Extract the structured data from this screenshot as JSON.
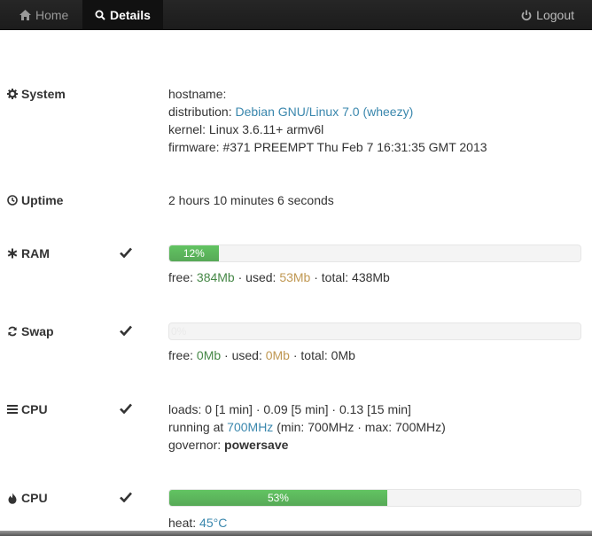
{
  "nav": {
    "home_label": "Home",
    "details_label": "Details",
    "logout_label": "Logout"
  },
  "system": {
    "label": "System",
    "hostname_label": "hostname:",
    "distribution_label": "distribution:",
    "distribution_value": "Debian GNU/Linux 7.0 (wheezy)",
    "kernel_label": "kernel:",
    "kernel_value": "Linux 3.6.11+ armv6l",
    "firmware_label": "firmware:",
    "firmware_value": "#371 PREEMPT Thu Feb 7 16:31:35 GMT 2013"
  },
  "uptime": {
    "label": "Uptime",
    "value": "2 hours 10 minutes 6 seconds"
  },
  "ram": {
    "label": "RAM",
    "percent_text": "12%",
    "percent": 12,
    "free_label": "free:",
    "free_value": "384Mb",
    "used_label": "· used:",
    "used_value": "53Mb",
    "total_label": "· total:",
    "total_value": "438Mb"
  },
  "swap": {
    "label": "Swap",
    "percent_text": "0%",
    "percent": 0,
    "free_label": "free:",
    "free_value": "0Mb",
    "used_label": "· used:",
    "used_value": "0Mb",
    "total_label": "· total:",
    "total_value": "0Mb"
  },
  "cpu": {
    "label": "CPU",
    "loads_text": "loads: 0 [1 min] · 0.09 [5 min] · 0.13 [15 min]",
    "running_label": "running at",
    "running_value": "700MHz",
    "running_range": "(min: 700MHz · max: 700MHz)",
    "governor_label": "governor:",
    "governor_value": "powersave"
  },
  "cpu_heat": {
    "label": "CPU",
    "percent_text": "53%",
    "percent": 53,
    "heat_label": "heat:",
    "heat_value": "45°C"
  },
  "icons": [
    "home-icon",
    "search-icon",
    "power-icon",
    "gear-icon",
    "clock-icon",
    "asterisk-icon",
    "refresh-icon",
    "list-icon",
    "fire-icon",
    "check-icon"
  ],
  "colors": {
    "navbar": "#1c1c1c",
    "link": "#3a87ad",
    "free": "#468847",
    "used": "#c09853",
    "bar": "#5eb95e"
  }
}
